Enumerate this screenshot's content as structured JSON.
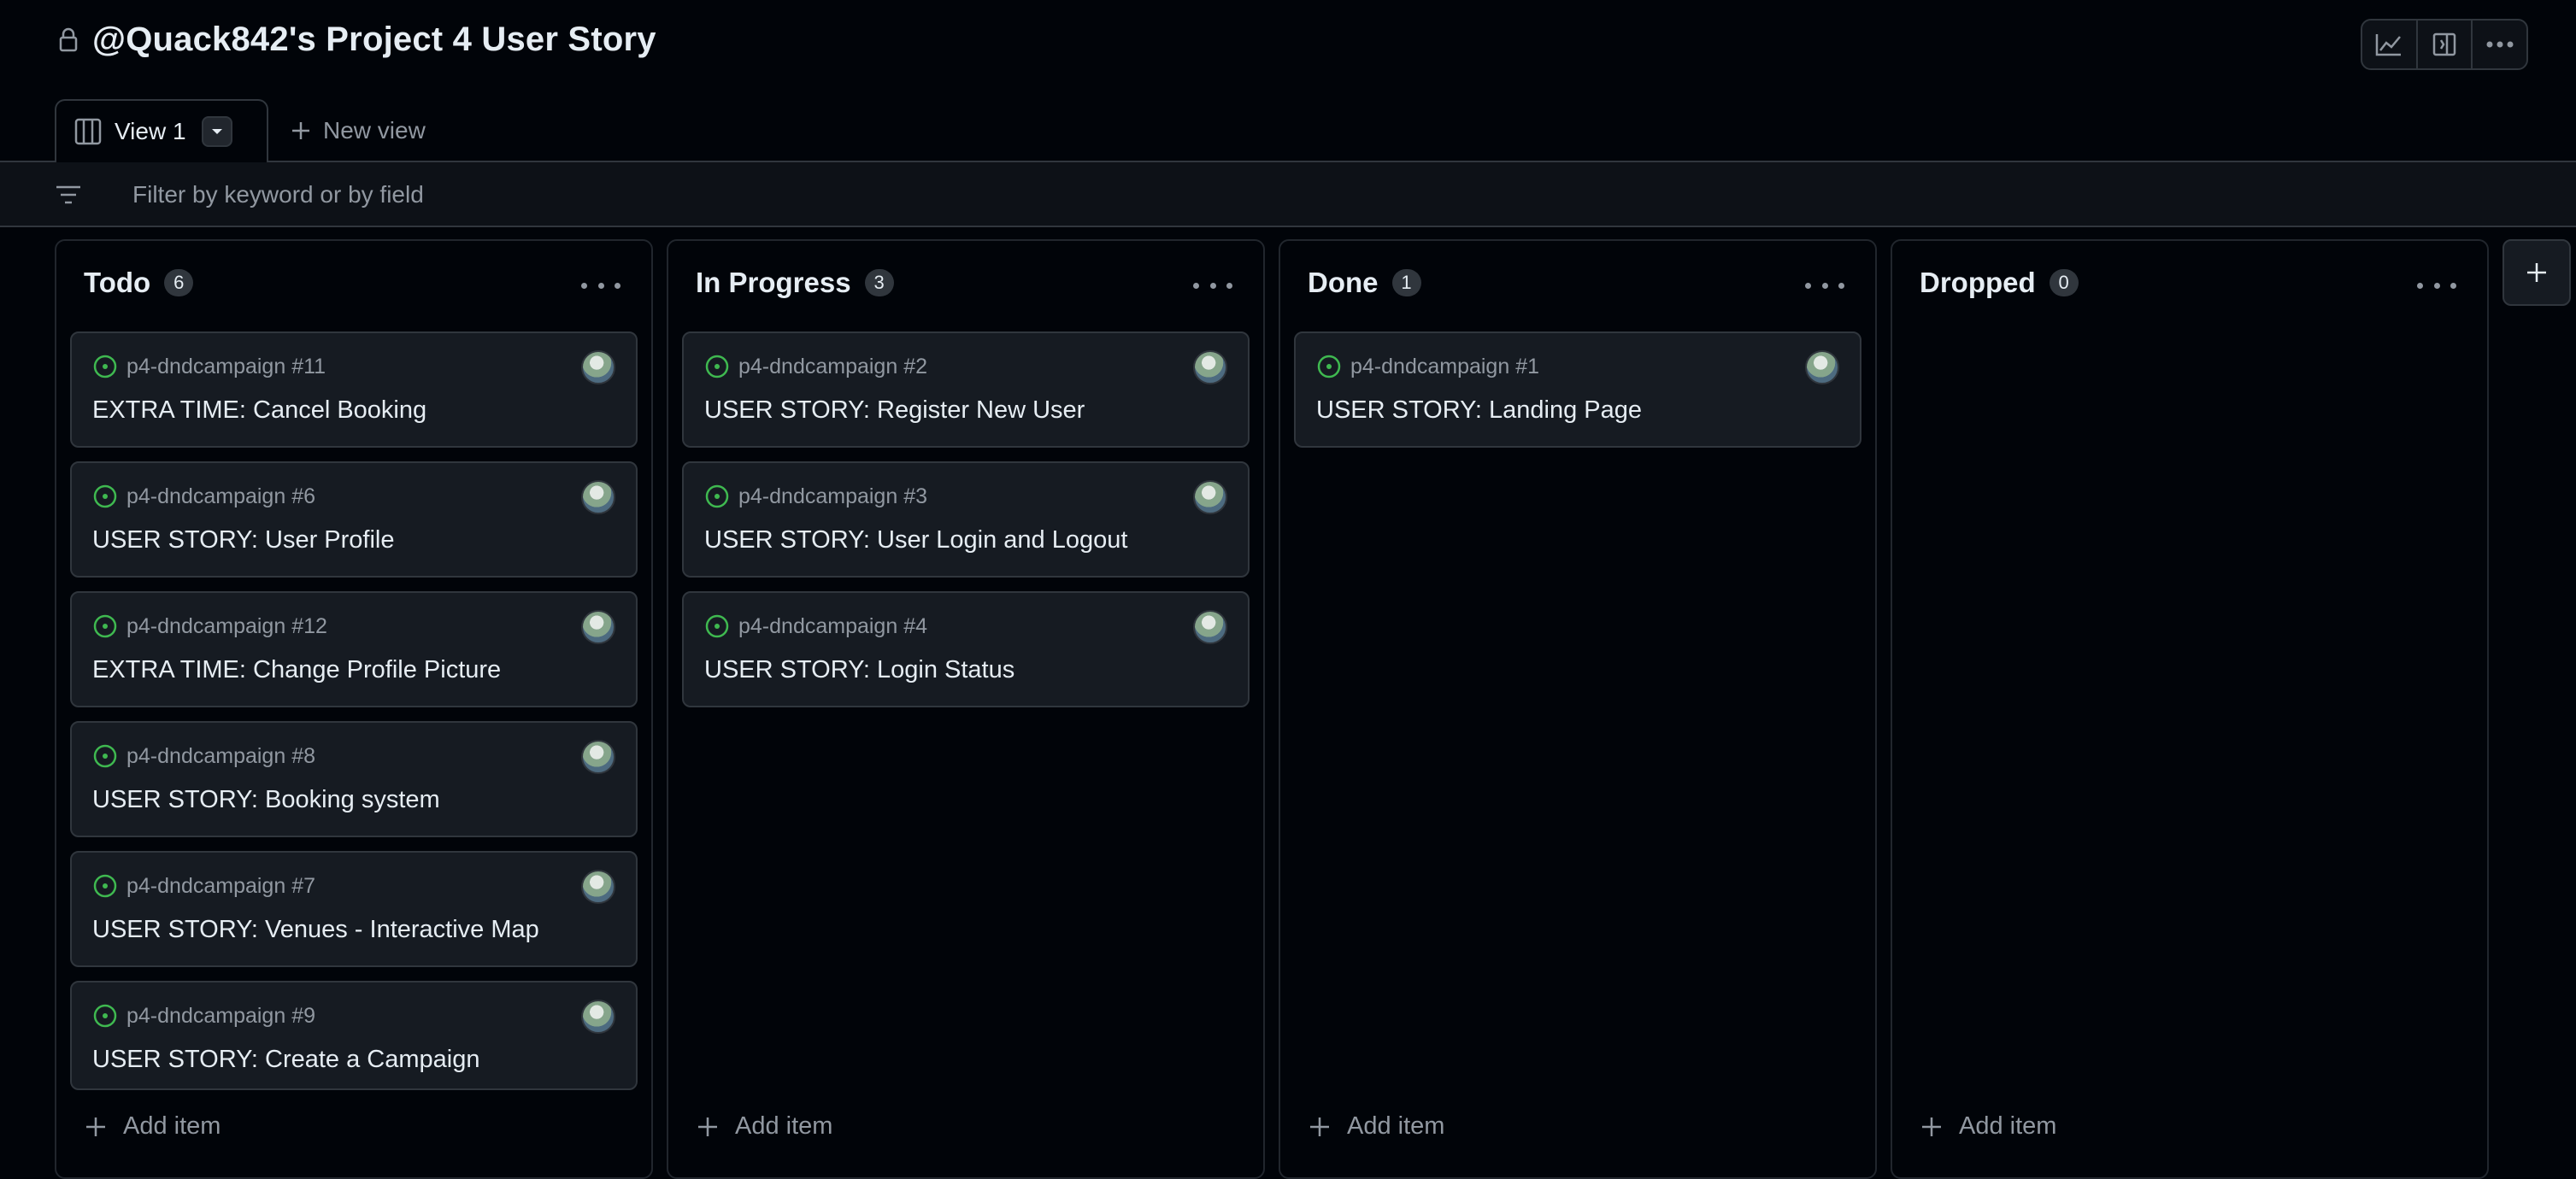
{
  "project": {
    "title": "@Quack842's Project 4 User Story"
  },
  "top_actions": {
    "insights_icon": "chart-line-icon",
    "layout_icon": "sidebar-icon",
    "more_icon": "more-horizontal-icon"
  },
  "tabs": {
    "active_label": "View 1",
    "new_view_label": "New view"
  },
  "filter": {
    "placeholder": "Filter by keyword or by field"
  },
  "columns": [
    {
      "name": "Todo",
      "count": "6",
      "add_item_label": "Add item",
      "cards": [
        {
          "ref": "p4-dndcampaign #11",
          "title": "EXTRA TIME: Cancel Booking"
        },
        {
          "ref": "p4-dndcampaign #6",
          "title": "USER STORY: User Profile"
        },
        {
          "ref": "p4-dndcampaign #12",
          "title": "EXTRA TIME: Change Profile Picture"
        },
        {
          "ref": "p4-dndcampaign #8",
          "title": "USER STORY: Booking system"
        },
        {
          "ref": "p4-dndcampaign #7",
          "title": "USER STORY: Venues - Interactive Map"
        },
        {
          "ref": "p4-dndcampaign #9",
          "title": "USER STORY: Create a Campaign"
        }
      ]
    },
    {
      "name": "In Progress",
      "count": "3",
      "add_item_label": "Add item",
      "cards": [
        {
          "ref": "p4-dndcampaign #2",
          "title": "USER STORY: Register New User"
        },
        {
          "ref": "p4-dndcampaign #3",
          "title": "USER STORY: User Login and Logout"
        },
        {
          "ref": "p4-dndcampaign #4",
          "title": "USER STORY: Login Status"
        }
      ]
    },
    {
      "name": "Done",
      "count": "1",
      "add_item_label": "Add item",
      "cards": [
        {
          "ref": "p4-dndcampaign #1",
          "title": "USER STORY: Landing Page"
        }
      ]
    },
    {
      "name": "Dropped",
      "count": "0",
      "add_item_label": "Add item",
      "cards": []
    }
  ],
  "colors": {
    "issue_open": "#3fb950",
    "background": "#010409",
    "card": "#161b22",
    "border": "#30363d"
  }
}
